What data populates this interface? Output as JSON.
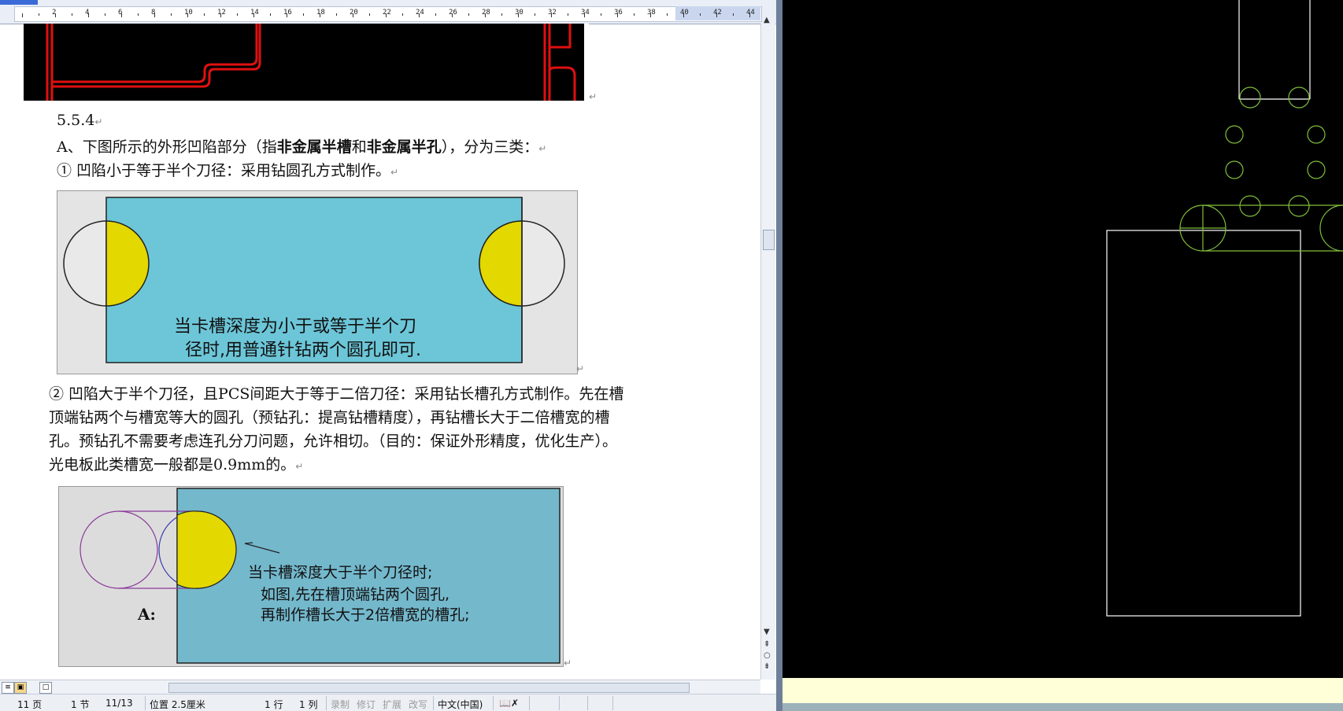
{
  "ruler": {
    "numbers": [
      "2",
      "4",
      "6",
      "8",
      "10",
      "12",
      "14",
      "16",
      "18",
      "20",
      "22",
      "24",
      "26",
      "28",
      "30",
      "32",
      "34",
      "36",
      "38",
      "40",
      "42",
      "44"
    ]
  },
  "document": {
    "section_heading": "5.5.4",
    "para_a_prefix": "A、下图所示的外形凹陷部分（指",
    "para_a_bold1": "非金属半槽",
    "para_a_mid": "和",
    "para_a_bold2": "非金属半孔",
    "para_a_suffix": "），分为三类：",
    "item1": "① 凹陷小于等于半个刀径：采用钻圆孔方式制作。",
    "figure1": {
      "caption_line1": "当卡槽深度为小于或等于半个刀",
      "caption_line2": "径时,用普通针钻两个圆孔即可."
    },
    "item2_lines": [
      "② 凹陷大于半个刀径，且PCS间距大于等于二倍刀径：采用钻长槽孔方式制作。先在槽",
      "顶端钻两个与槽宽等大的圆孔（预钻孔：提高钻槽精度），再钻槽长大于二倍槽宽的槽",
      "孔。预钻孔不需要考虑连孔分刀问题，允许相切。（目的：保证外形精度，优化生产）。",
      "光电板此类槽宽一般都是0.9mm的。"
    ],
    "figure2": {
      "label": "A:",
      "text_line1": "当卡槽深度大于半个刀径时;",
      "text_line2": "如图,先在槽顶端钻两个圆孔,",
      "text_line3": "再制作槽长大于2倍槽宽的槽孔;"
    },
    "paragraph_mark": "↵"
  },
  "status_bar": {
    "page": "11 页",
    "section": "1 节",
    "page_of": "11/13",
    "position": "位置 2.5厘米",
    "line": "1 行",
    "column": "1 列",
    "rec": "录制",
    "trk": "修订",
    "ext": "扩展",
    "ovr": "改写",
    "language": "中文(中国)"
  },
  "colors": {
    "cad_trace": "#e01010",
    "figure_fill": "#6cc6d8",
    "figure2_fill": "#74b8cc",
    "drill_yellow": "#e3d800",
    "cad_green": "#7fbf3a",
    "cad_white": "#ffffff"
  },
  "icons": [
    "ruler-tab-icon",
    "view-normal-icon",
    "view-print-icon",
    "view-reading-icon",
    "scroll-up-icon",
    "scroll-down-icon",
    "prev-page-icon",
    "next-page-icon",
    "select-browse-icon",
    "spell-check-icon"
  ]
}
